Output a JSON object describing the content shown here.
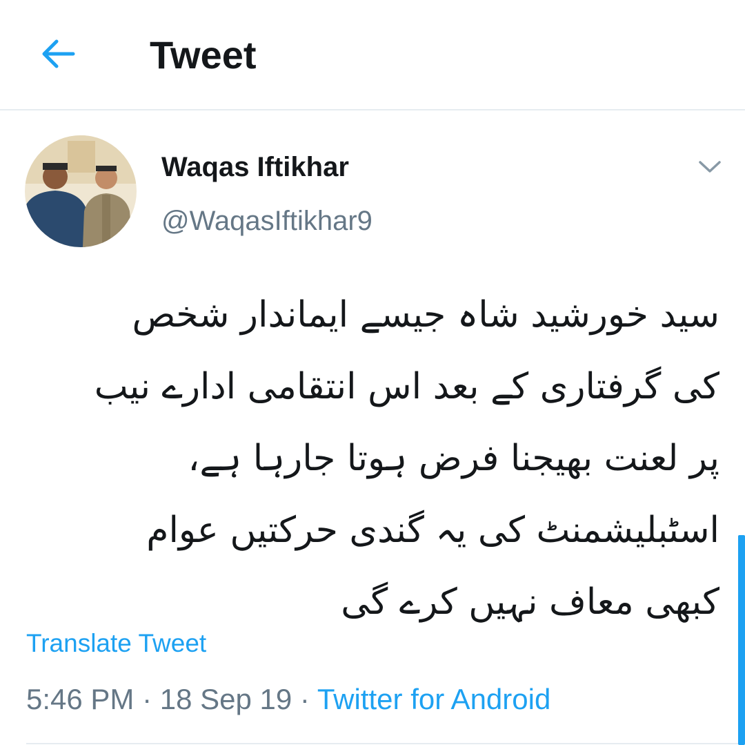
{
  "app_bar": {
    "title": "Tweet",
    "back_icon": "arrow-left-icon"
  },
  "tweet": {
    "author": {
      "display_name": "Waqas Iftikhar",
      "handle": "@WaqasIftikhar9",
      "avatar_icon": "avatar-photo"
    },
    "more_icon": "chevron-down-icon",
    "text_lines": [
      "سید خورشید شاہ جیسے ایماندار  شخص",
      "کی گرفتاری کے بعد اس انتقامی ادارے نیب",
      "پر لعنت بھیجنا فرض ہوتا جارہا ہے،",
      "اسٹبلیشمنٹ کی یہ گندی حرکتیں عوام",
      "کبھی معاف نہیں کرے گی"
    ],
    "translate_label": "Translate Tweet",
    "time": "5:46 PM",
    "separator": " · ",
    "date": "18 Sep 19",
    "source": "Twitter for Android"
  },
  "colors": {
    "accent": "#1da1f2",
    "text_primary": "#14171a",
    "text_secondary": "#657786",
    "divider": "#e6ecf0"
  }
}
